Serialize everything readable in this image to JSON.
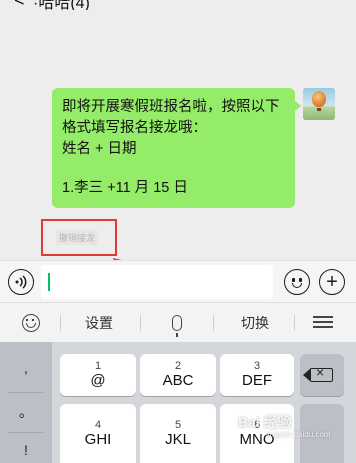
{
  "header": {
    "back_glyph": "<",
    "title": "·哈哈(4)"
  },
  "chat": {
    "message_lines": [
      "即将开展寒假班报名啦，按照以下",
      "格式填写报名接龙哦：",
      "姓名 + 日期",
      "",
      "1.李三 +11 月 15 日"
    ],
    "draft_label": "撤销接龙"
  },
  "input_bar": {
    "voice_icon": "voice-icon",
    "emoji_icon": "emoji-icon",
    "plus_icon": "plus-icon",
    "caret_color": "#07c160"
  },
  "keyboard_toolbar": {
    "settings_label": "设置",
    "switch_label": "切换"
  },
  "keyboard": {
    "side_punct": [
      ",",
      "。",
      "!"
    ],
    "keys": [
      {
        "num": "1",
        "lbl": "@"
      },
      {
        "num": "2",
        "lbl": "ABC"
      },
      {
        "num": "3",
        "lbl": "DEF"
      },
      {
        "num": "4",
        "lbl": "GHI"
      },
      {
        "num": "5",
        "lbl": "JKL"
      },
      {
        "num": "6",
        "lbl": "MNO"
      }
    ]
  },
  "watermark": {
    "text": "Bai 经验",
    "sub": "jingyan.baidu.com"
  },
  "colors": {
    "bubble": "#95ec69",
    "highlight": "#e23b37",
    "accent": "#07c160"
  }
}
